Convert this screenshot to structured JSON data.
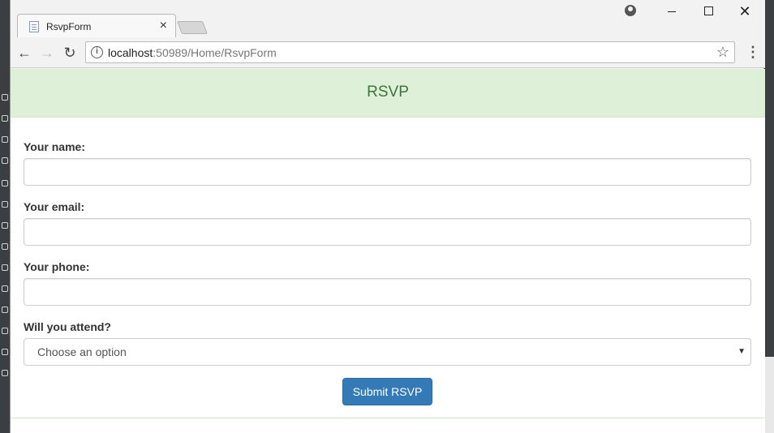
{
  "browser": {
    "tab_title": "RsvpForm",
    "tab_close": "×",
    "url_host": "localhost",
    "url_path": ":50989/Home/RsvpForm",
    "window_close": "✕"
  },
  "page": {
    "banner_title": "RSVP",
    "fields": [
      {
        "label": "Your name:",
        "value": ""
      },
      {
        "label": "Your email:",
        "value": ""
      },
      {
        "label": "Your phone:",
        "value": ""
      }
    ],
    "attend_label": "Will you attend?",
    "attend_selected": "Choose an option",
    "submit_label": "Submit RSVP"
  },
  "colors": {
    "banner_bg": "#dff0d8",
    "banner_text": "#3c763d",
    "button_primary": "#337ab7"
  }
}
